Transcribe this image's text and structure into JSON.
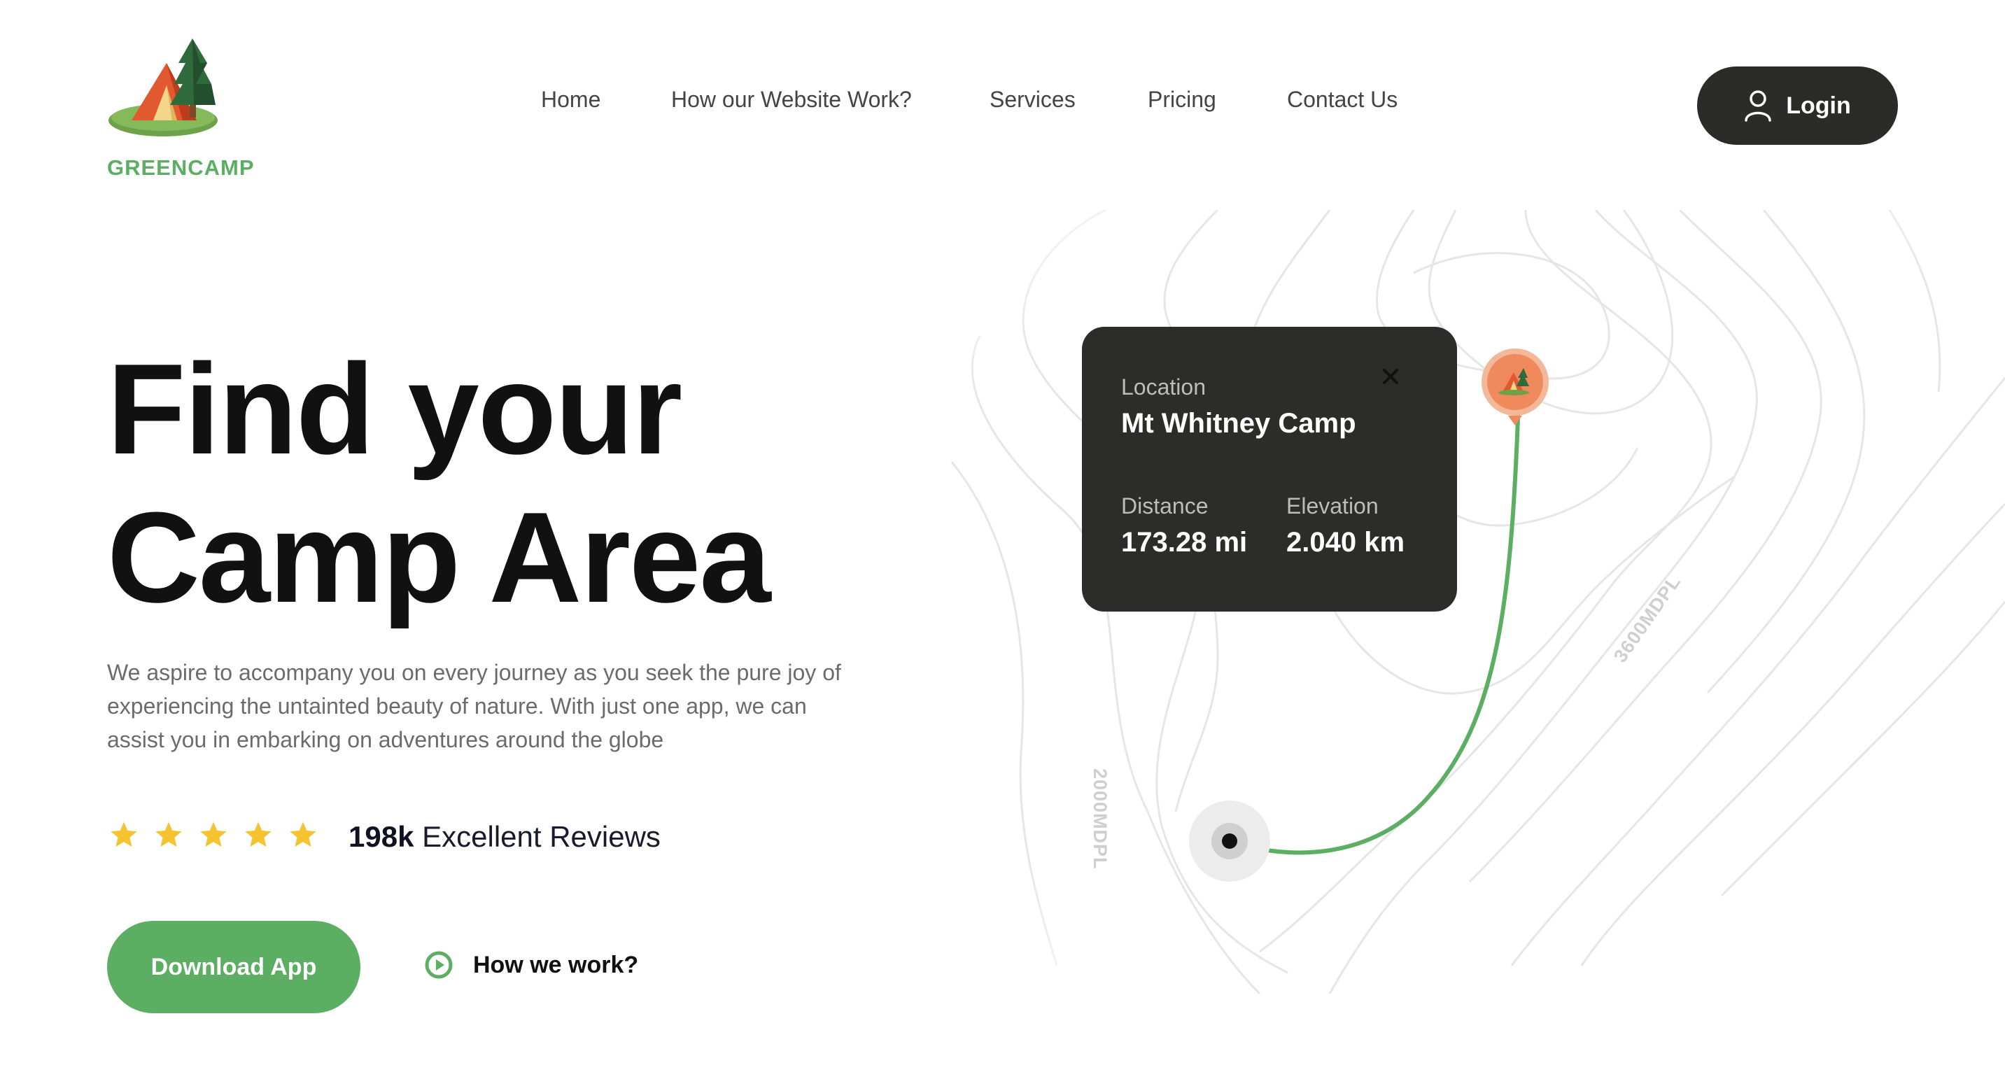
{
  "brand": {
    "name": "GREENCAMP"
  },
  "nav": {
    "items": [
      {
        "label": "Home"
      },
      {
        "label": "How our Website Work?"
      },
      {
        "label": "Services"
      },
      {
        "label": "Pricing"
      },
      {
        "label": "Contact Us"
      }
    ],
    "login_label": "Login"
  },
  "hero": {
    "title_line1": "Find your",
    "title_line2": "Camp Area",
    "description": "We aspire to accompany you on every journey as you seek the pure joy of experiencing the untainted beauty of nature. With just one app, we can assist you in embarking on adventures around the globe",
    "rating_stars": 5,
    "reviews_count": "198k",
    "reviews_text": "Excellent Reviews",
    "download_label": "Download App",
    "how_label": "How we work?"
  },
  "map": {
    "card": {
      "location_label": "Location",
      "location_name": "Mt Whitney Camp",
      "distance_label": "Distance",
      "distance_value": "173.28 mi",
      "elevation_label": "Elevation",
      "elevation_value": "2.040 km"
    },
    "contour_labels": [
      "2000MDPL",
      "3600MDPL"
    ]
  },
  "colors": {
    "brand_green": "#5cae63",
    "dark": "#2b2c29",
    "star": "#f5c330",
    "pin": "#f08a5d"
  },
  "icons": [
    "tent-tree-logo",
    "user-icon",
    "star-icon",
    "play-circle-icon",
    "close-icon",
    "camp-pin-icon",
    "start-point-icon"
  ]
}
